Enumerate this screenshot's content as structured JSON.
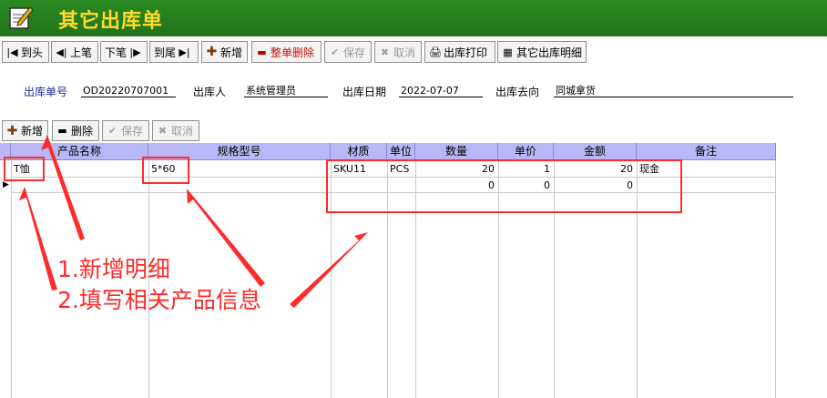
{
  "window": {
    "title": "其它出库单",
    "icon": "notepad-pencil-icon"
  },
  "toolbar": [
    {
      "label": "到头",
      "icon": "first-record-icon",
      "state": "enabled"
    },
    {
      "label": "上笔",
      "icon": "prev-record-icon",
      "state": "enabled"
    },
    {
      "label": "下笔",
      "icon": "next-record-icon",
      "state": "enabled"
    },
    {
      "label": "到尾",
      "icon": "last-record-icon",
      "state": "enabled"
    },
    {
      "label": "新增",
      "icon": "plus-icon",
      "state": "enabled"
    },
    {
      "label": "整单删除",
      "icon": "minus-icon",
      "state": "enabled"
    },
    {
      "label": "保存",
      "icon": "check-icon",
      "state": "disabled"
    },
    {
      "label": "取消",
      "icon": "x-icon",
      "state": "disabled"
    },
    {
      "label": "出库打印",
      "icon": "printer-icon",
      "state": "enabled"
    },
    {
      "label": "其它出库明细",
      "icon": "table-icon",
      "state": "enabled"
    }
  ],
  "form": {
    "doc_no_label": "出库单号",
    "doc_no_value": "OD20220707001",
    "person_label": "出库人",
    "person_value": "系统管理员",
    "date_label": "出库日期",
    "date_value": "2022-07-07",
    "dest_label": "出库去向",
    "dest_value": "同城拿货"
  },
  "detail_toolbar": [
    {
      "label": "新增",
      "icon": "plus-icon",
      "state": "enabled"
    },
    {
      "label": "删除",
      "icon": "minus-icon",
      "state": "enabled"
    },
    {
      "label": "保存",
      "icon": "check-icon",
      "state": "disabled"
    },
    {
      "label": "取消",
      "icon": "x-icon",
      "state": "disabled"
    }
  ],
  "grid": {
    "columns": [
      "产品名称",
      "规格型号",
      "材质",
      "单位",
      "数量",
      "单价",
      "金额",
      "备注"
    ],
    "rows": [
      {
        "name": "T恤",
        "spec": "5*60",
        "material": "SKU11",
        "unit": "PCS",
        "qty": "20",
        "price": "1",
        "amount": "20",
        "note": "现金"
      },
      {
        "name": "",
        "spec": "",
        "material": "",
        "unit": "",
        "qty": "0",
        "price": "0",
        "amount": "0",
        "note": ""
      }
    ]
  },
  "annotations": {
    "step1": "1.新增明细",
    "step2": "2.填写相关产品信息",
    "color": "#ff2a2a"
  }
}
